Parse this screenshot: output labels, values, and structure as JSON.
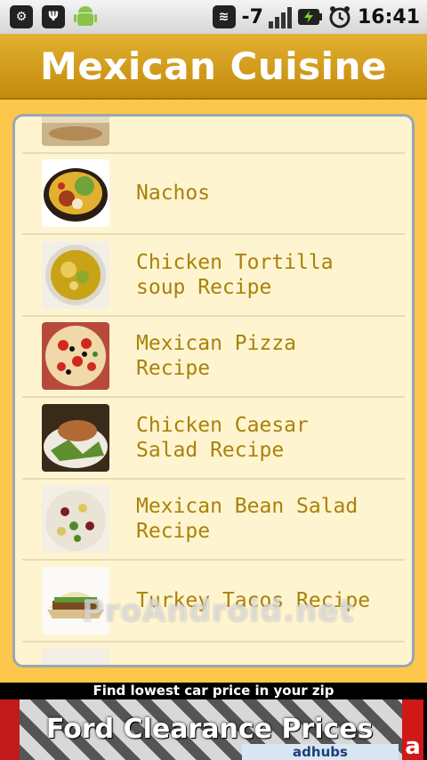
{
  "status_bar": {
    "signal_value": "-7",
    "time": "16:41",
    "icons": [
      "android-debug-icon",
      "usb-icon",
      "android-icon",
      "wifi-icon",
      "signal-icon",
      "battery-icon",
      "alarm-icon"
    ]
  },
  "header": {
    "title": "Mexican Cuisine"
  },
  "recipes": [
    {
      "label": ""
    },
    {
      "label": "Nachos"
    },
    {
      "label": "Chicken Tortilla\nsoup Recipe"
    },
    {
      "label": "Mexican Pizza\nRecipe"
    },
    {
      "label": "Chicken Caesar\nSalad Recipe"
    },
    {
      "label": "Mexican Bean Salad\nRecipe"
    },
    {
      "label": "Turkey Tacos Recipe"
    },
    {
      "label": ""
    }
  ],
  "watermark": "ProAndroid.net",
  "ad": {
    "top_text": "Find lowest car price in your zip",
    "title": "Ford Clearance Prices",
    "brand": "adhubs",
    "corner": "a"
  },
  "colors": {
    "title_bar": "#d9a21c",
    "background": "#fcc74a",
    "list_bg": "#fff4d0",
    "label": "#a8820a"
  }
}
